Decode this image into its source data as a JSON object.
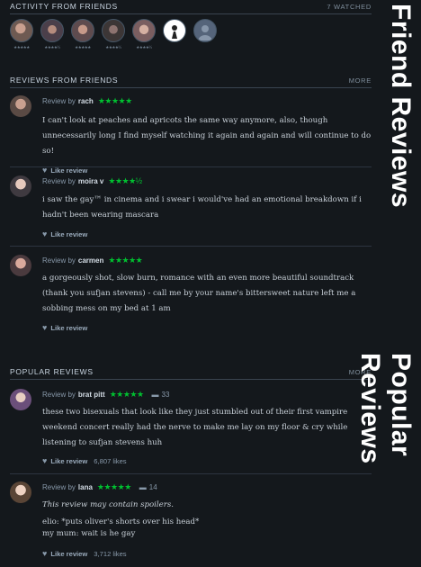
{
  "activity": {
    "title": "ACTIVITY FROM FRIENDS",
    "count": "7 WATCHED",
    "friends": [
      {
        "avatar_color": "#6e5a52",
        "stars": "★★★★★"
      },
      {
        "avatar_color": "#4b3f4a",
        "stars": "★★★★½"
      },
      {
        "avatar_color": "#5e4b4e",
        "stars": "★★★★★"
      },
      {
        "avatar_color": "#3c3636",
        "stars": "★★★★½"
      },
      {
        "avatar_color": "#7a5e60",
        "stars": "★★★★½"
      },
      {
        "avatar_color": "#ffffff",
        "stars": ""
      },
      {
        "avatar_color": "#55647a",
        "stars": ""
      }
    ]
  },
  "friend_reviews": {
    "title": "REVIEWS FROM FRIENDS",
    "more": "MORE",
    "items": [
      {
        "by": "Review by",
        "user": "rach",
        "stars": "★★★★★",
        "text": "I can't look at peaches and apricots the same way anymore, also, though unnecessarily long I find myself watching it again and again and will continue to do so!",
        "like": "Like review"
      },
      {
        "by": "Review by",
        "user": "moira v",
        "stars": "★★★★½",
        "text": "i saw the gay™ in cinema and i swear i would've had an emotional breakdown if i hadn't been wearing mascara",
        "like": "Like review"
      },
      {
        "by": "Review by",
        "user": "carmen",
        "stars": "★★★★★",
        "text": "a gorgeously shot, slow burn, romance with an even more beautiful soundtrack (thank you sufjan stevens) - call me by your name's bittersweet nature left me a sobbing mess on my bed at 1 am",
        "like": "Like review"
      }
    ]
  },
  "popular_reviews": {
    "title": "POPULAR REVIEWS",
    "more": "MORE",
    "items": [
      {
        "by": "Review by",
        "user": "brat pitt",
        "stars": "★★★★★",
        "comments": "33",
        "text": "these two bisexuals that look like they just stumbled out of their first vampire weekend concert really had the nerve to make me lay on my floor & cry while listening to sufjan stevens huh",
        "like": "Like review",
        "likes": "6,807 likes"
      },
      {
        "by": "Review by",
        "user": "lana",
        "stars": "★★★★★",
        "comments": "14",
        "spoiler": "This review may contain spoilers.",
        "line1": "elio: *puts oliver's shorts over his head*",
        "line2": "my mum: wait is he gay",
        "like": "Like review",
        "likes": "3,712 likes"
      }
    ]
  },
  "side_labels": {
    "top": "Friend Reviews",
    "bottom": "Popular Reviews"
  },
  "colors": {
    "background": "#14181c",
    "star_green": "#00c030",
    "text": "#c8d0d8"
  }
}
